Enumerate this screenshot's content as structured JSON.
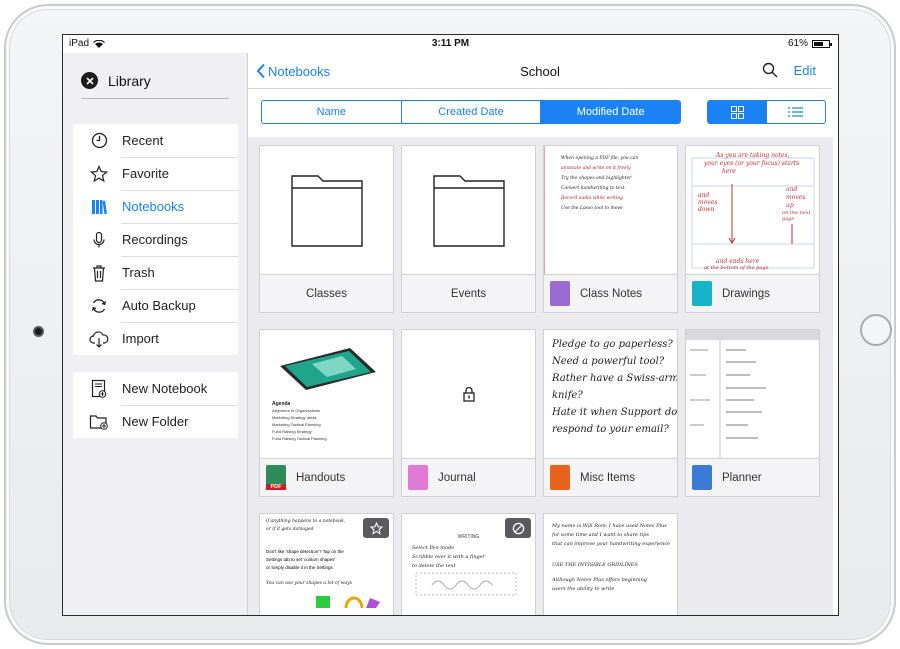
{
  "status_bar": {
    "device": "iPad",
    "time": "3:11 PM",
    "battery": "61%",
    "battery_level": 0.61
  },
  "sidebar": {
    "header_title": "Library",
    "primary_items": [
      {
        "label": "Recent",
        "icon": "clock-icon",
        "active": false
      },
      {
        "label": "Favorite",
        "icon": "star-icon",
        "active": false
      },
      {
        "label": "Notebooks",
        "icon": "books-icon",
        "active": true
      },
      {
        "label": "Recordings",
        "icon": "microphone-icon",
        "active": false
      },
      {
        "label": "Trash",
        "icon": "trash-icon",
        "active": false
      },
      {
        "label": "Auto Backup",
        "icon": "sync-icon",
        "active": false
      },
      {
        "label": "Import",
        "icon": "cloud-download-icon",
        "active": false
      }
    ],
    "create_items": [
      {
        "label": "New Notebook",
        "icon": "new-notebook-icon"
      },
      {
        "label": "New Folder",
        "icon": "new-folder-icon"
      }
    ]
  },
  "navbar": {
    "back_label": "Notebooks",
    "title": "School",
    "edit_label": "Edit"
  },
  "sort_tabs": [
    {
      "label": "Name",
      "selected": false
    },
    {
      "label": "Created Date",
      "selected": false
    },
    {
      "label": "Modified Date",
      "selected": true
    }
  ],
  "view_mode": {
    "options": [
      "grid-view-icon",
      "list-view-icon"
    ],
    "selected": "grid-view-icon"
  },
  "items": [
    {
      "label": "Classes",
      "type": "folder"
    },
    {
      "label": "Events",
      "type": "folder"
    },
    {
      "label": "Class Notes",
      "type": "notebook",
      "cover_color": "#9b6bd3"
    },
    {
      "label": "Drawings",
      "type": "notebook",
      "cover_color": "#17b3c8"
    },
    {
      "label": "Handouts",
      "type": "pdf",
      "cover_color": "#2e8b57",
      "cover_text": "PDF"
    },
    {
      "label": "Journal",
      "type": "notebook",
      "cover_color": "#e07ad6",
      "locked": true
    },
    {
      "label": "Misc Items",
      "type": "notebook",
      "cover_color": "#e8621e"
    },
    {
      "label": "Planner",
      "type": "notebook",
      "cover_color": "#3a7bd5"
    }
  ],
  "previews": {
    "class_notes_lines": [
      "When opening a PDF file, you can",
      "annotate and write on it freely",
      "Try the shapes and highlighter",
      "Convert handwriting to text",
      "Record audio while writing",
      "Use the Lasso tool to move"
    ],
    "drawings_text": [
      "As you are taking notes,",
      "your eyes (or your focus) starts",
      "here",
      "and",
      "moves",
      "down",
      "and ends here",
      "at the bottom of the page",
      "and",
      "moves",
      "up",
      "on the next page"
    ],
    "handouts_heading": "Agenda",
    "handouts_list": [
      "Alignment of Organizations",
      "Marketing Strategy Ideas",
      "Marketing Tactical Planning",
      "Fund Raising Strategy",
      "Fund Raising Tactical Planning"
    ],
    "misc_lines": [
      "Pledge to go paperless?",
      "Need a powerful tool?",
      "Rather have a Swiss-army",
      "knife?",
      "Hate it when Support don't",
      "respond to your email?"
    ],
    "row3_a": [
      "if anything happens to a notebook,",
      "or if it gets damaged",
      "Don't like 'shape detection'? Tap on the",
      "Settings tab to set 'custom shapes'",
      "or simply disable it in the Settings",
      "You can use your shapes a lot of ways"
    ],
    "row3_b": [
      "Select Pen mode",
      "Scribble over it with a finger",
      "to delete the text",
      "WRITING"
    ],
    "row3_c": [
      "My name is Will Rom. I have used Notes Plus",
      "for some time and I want to share tips",
      "that can improve your handwriting experience",
      "USE THE INVISIBLE GRIDLINES",
      "Although Notes Plus offers beginning",
      "users the ability to write"
    ]
  }
}
